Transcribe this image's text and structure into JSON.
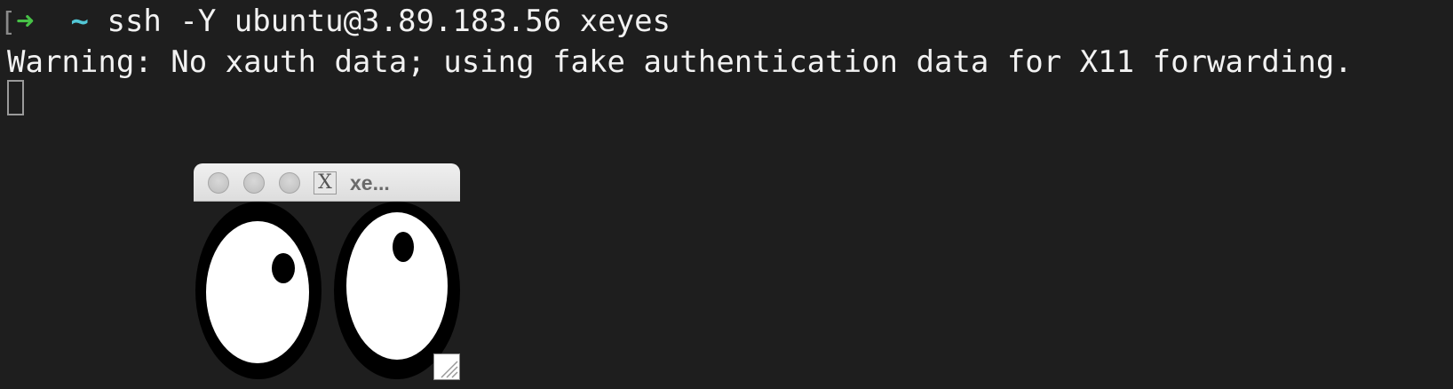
{
  "terminal": {
    "prompt_bracket": "[",
    "prompt_arrow": "➜",
    "prompt_dir": "~",
    "command": "ssh -Y ubuntu@3.89.183.56 xeyes",
    "output_line": "Warning: No xauth data; using fake authentication data for X11 forwarding."
  },
  "xeyes_window": {
    "title": "xe...",
    "app_icon_glyph": "X",
    "buttons": [
      "close-button",
      "minimize-button",
      "zoom-button"
    ],
    "icons": [
      "x11-app-icon",
      "resize-grip-icon"
    ]
  },
  "colors": {
    "background": "#1e1e1e",
    "prompt_arrow": "#47c247",
    "prompt_dir": "#52c7d6",
    "text": "#f2f2f2"
  }
}
